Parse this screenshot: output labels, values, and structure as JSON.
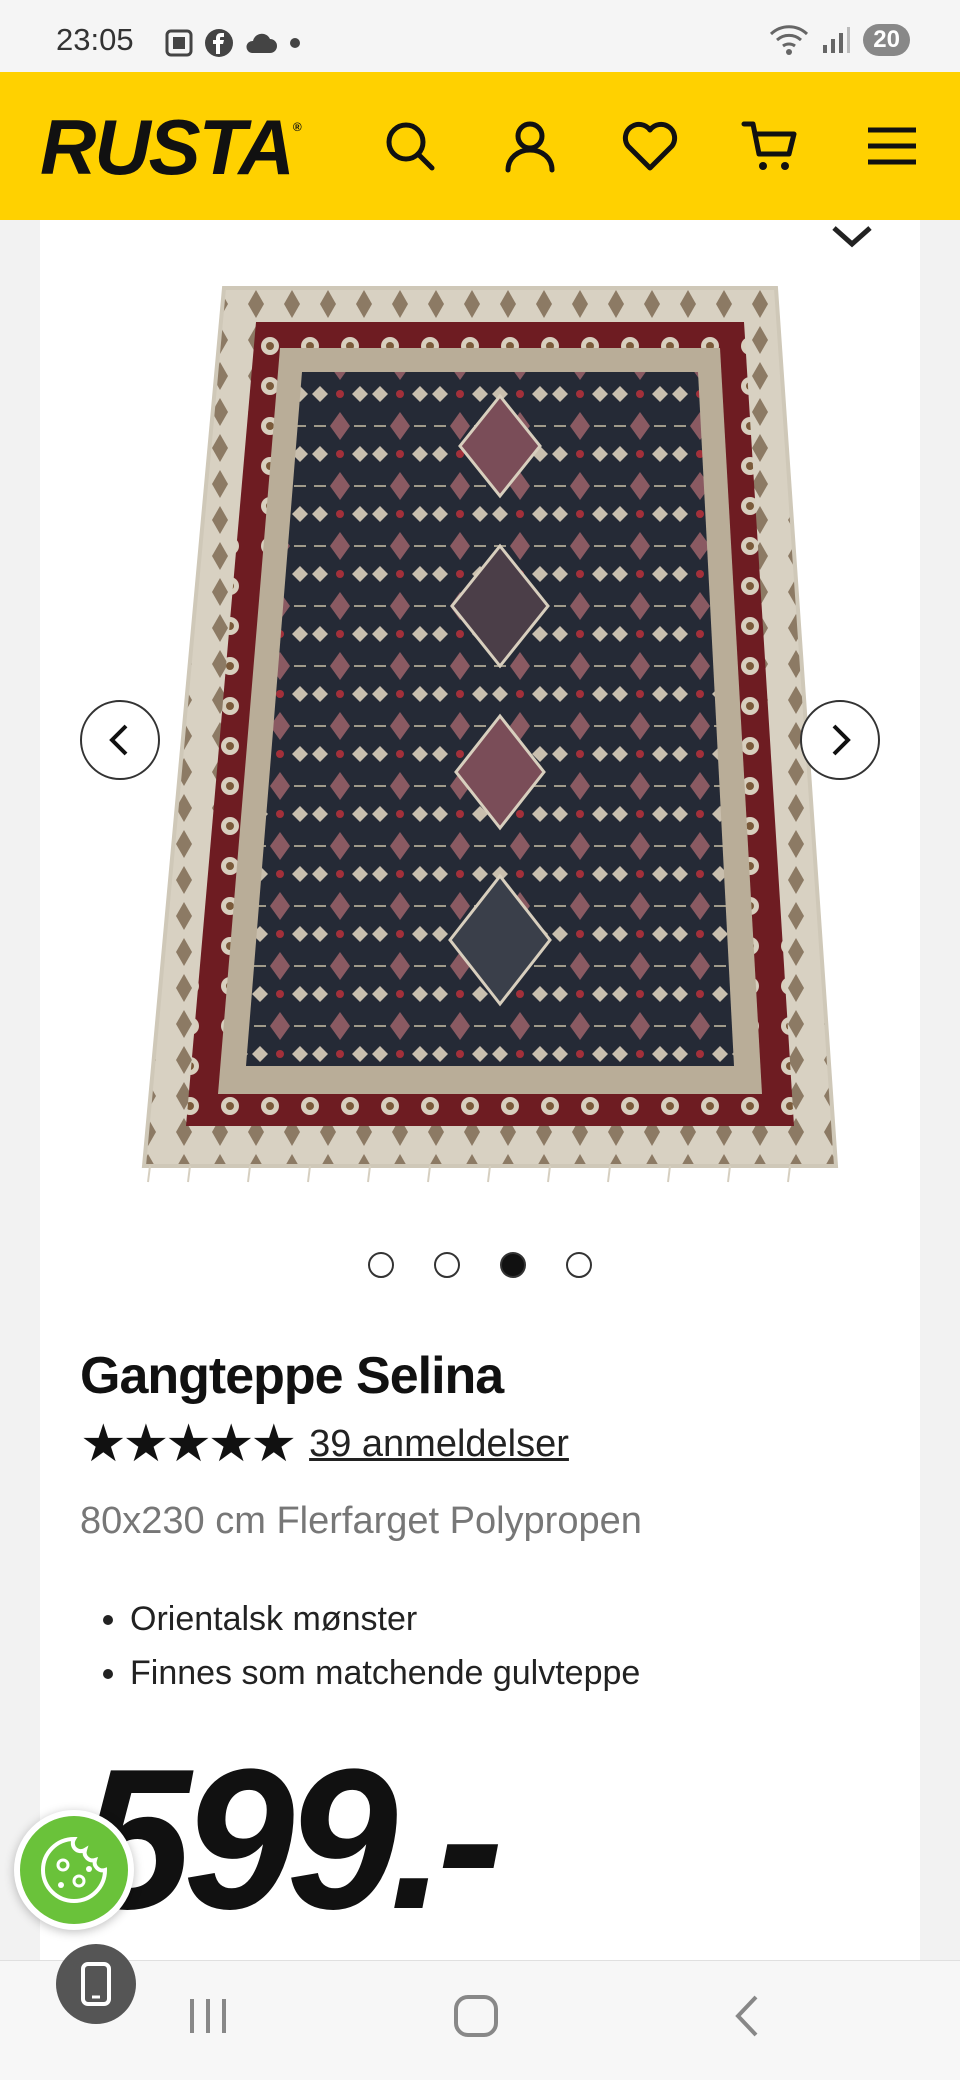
{
  "status": {
    "time": "23:05",
    "battery": "20"
  },
  "header": {
    "logo": "RUSTA",
    "logo_mark": "®"
  },
  "product": {
    "title": "Gangteppe Selina",
    "stars": "★★★★★",
    "reviews": "39 anmeldelser",
    "subtitle": "80x230 cm Flerfarget Polypropen",
    "bullets": [
      "Orientalsk mønster",
      "Finnes som matchende gulvteppe"
    ],
    "price": "599.-"
  },
  "carousel": {
    "total": 4,
    "active_index": 2
  },
  "colors": {
    "brand": "#ffd100",
    "cookie": "#6ac23a",
    "text": "#111111"
  },
  "icons": [
    "search-icon",
    "user-icon",
    "heart-icon",
    "cart-icon",
    "menu-icon",
    "chevron-left-icon",
    "chevron-right-icon",
    "cookie-icon",
    "phone-icon"
  ]
}
